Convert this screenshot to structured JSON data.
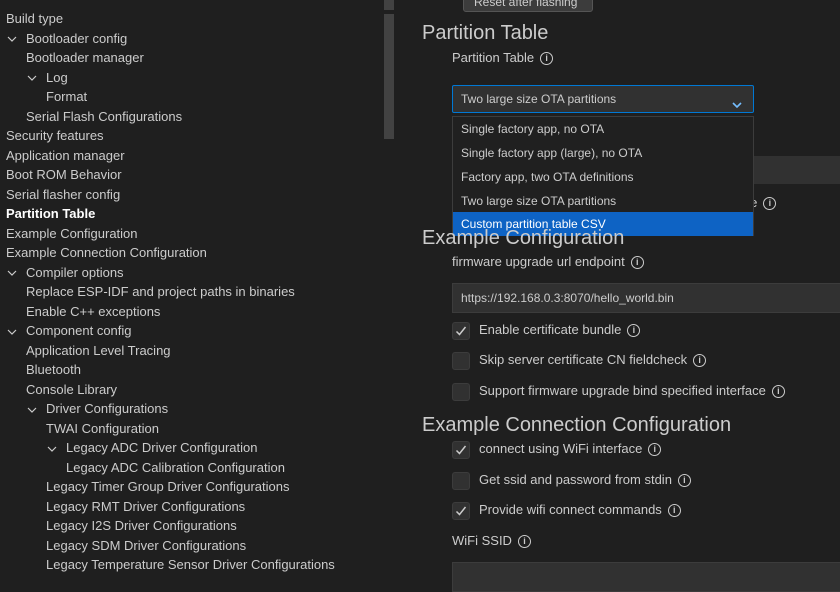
{
  "sidebar": {
    "items": [
      {
        "label": "Build type",
        "indent": 0,
        "chevron": false,
        "active": false
      },
      {
        "label": "Bootloader config",
        "indent": 0,
        "chevron": true,
        "active": false
      },
      {
        "label": "Bootloader manager",
        "indent": 1,
        "chevron": false,
        "active": false
      },
      {
        "label": "Log",
        "indent": 1,
        "chevron": true,
        "active": false
      },
      {
        "label": "Format",
        "indent": 2,
        "chevron": false,
        "active": false
      },
      {
        "label": "Serial Flash Configurations",
        "indent": 1,
        "chevron": false,
        "active": false
      },
      {
        "label": "Security features",
        "indent": 0,
        "chevron": false,
        "active": false
      },
      {
        "label": "Application manager",
        "indent": 0,
        "chevron": false,
        "active": false
      },
      {
        "label": "Boot ROM Behavior",
        "indent": 0,
        "chevron": false,
        "active": false
      },
      {
        "label": "Serial flasher config",
        "indent": 0,
        "chevron": false,
        "active": false
      },
      {
        "label": "Partition Table",
        "indent": 0,
        "chevron": false,
        "active": true
      },
      {
        "label": "Example Configuration",
        "indent": 0,
        "chevron": false,
        "active": false
      },
      {
        "label": "Example Connection Configuration",
        "indent": 0,
        "chevron": false,
        "active": false
      },
      {
        "label": "Compiler options",
        "indent": 0,
        "chevron": true,
        "active": false
      },
      {
        "label": "Replace ESP-IDF and project paths in binaries",
        "indent": 1,
        "chevron": false,
        "active": false
      },
      {
        "label": "Enable C++ exceptions",
        "indent": 1,
        "chevron": false,
        "active": false
      },
      {
        "label": "Component config",
        "indent": 0,
        "chevron": true,
        "active": false
      },
      {
        "label": "Application Level Tracing",
        "indent": 1,
        "chevron": false,
        "active": false
      },
      {
        "label": "Bluetooth",
        "indent": 1,
        "chevron": false,
        "active": false
      },
      {
        "label": "Console Library",
        "indent": 1,
        "chevron": false,
        "active": false
      },
      {
        "label": "Driver Configurations",
        "indent": 1,
        "chevron": true,
        "active": false
      },
      {
        "label": "TWAI Configuration",
        "indent": 2,
        "chevron": false,
        "active": false
      },
      {
        "label": "Legacy ADC Driver Configuration",
        "indent": 2,
        "chevron": true,
        "active": false
      },
      {
        "label": "Legacy ADC Calibration Configuration",
        "indent": 3,
        "chevron": false,
        "active": false
      },
      {
        "label": "Legacy Timer Group Driver Configurations",
        "indent": 2,
        "chevron": false,
        "active": false
      },
      {
        "label": "Legacy RMT Driver Configurations",
        "indent": 2,
        "chevron": false,
        "active": false
      },
      {
        "label": "Legacy I2S Driver Configurations",
        "indent": 2,
        "chevron": false,
        "active": false
      },
      {
        "label": "Legacy SDM Driver Configurations",
        "indent": 2,
        "chevron": false,
        "active": false
      },
      {
        "label": "Legacy Temperature Sensor Driver Configurations",
        "indent": 2,
        "chevron": false,
        "active": false
      }
    ]
  },
  "top_button": {
    "label": "Reset after flashing"
  },
  "partition_section": {
    "title": "Partition Table",
    "field_label": "Partition Table",
    "selected": "Two large size OTA partitions",
    "options": [
      "Single factory app, no OTA",
      "Single factory app (large), no OTA",
      "Factory app, two OTA definitions",
      "Two large size OTA partitions",
      "Custom partition table CSV"
    ],
    "highlighted_option_index": 4,
    "partial_label": "ble"
  },
  "example_section": {
    "title": "Example Configuration",
    "url_label": "firmware upgrade url endpoint",
    "url_value": "https://192.168.0.3:8070/hello_world.bin",
    "checkboxes": [
      {
        "label": "Enable certificate bundle",
        "checked": true
      },
      {
        "label": "Skip server certificate CN fieldcheck",
        "checked": false
      },
      {
        "label": "Support firmware upgrade bind specified interface",
        "checked": false
      }
    ]
  },
  "connection_section": {
    "title": "Example Connection Configuration",
    "checkboxes": [
      {
        "label": "connect using WiFi interface",
        "checked": true
      },
      {
        "label": "Get ssid and password from stdin",
        "checked": false
      },
      {
        "label": "Provide wifi connect commands",
        "checked": true
      }
    ],
    "ssid_label": "WiFi SSID"
  },
  "colors": {
    "accent": "#0078d4",
    "background": "#1f1f1f",
    "input": "#313131",
    "highlight": "#0e63c4"
  }
}
